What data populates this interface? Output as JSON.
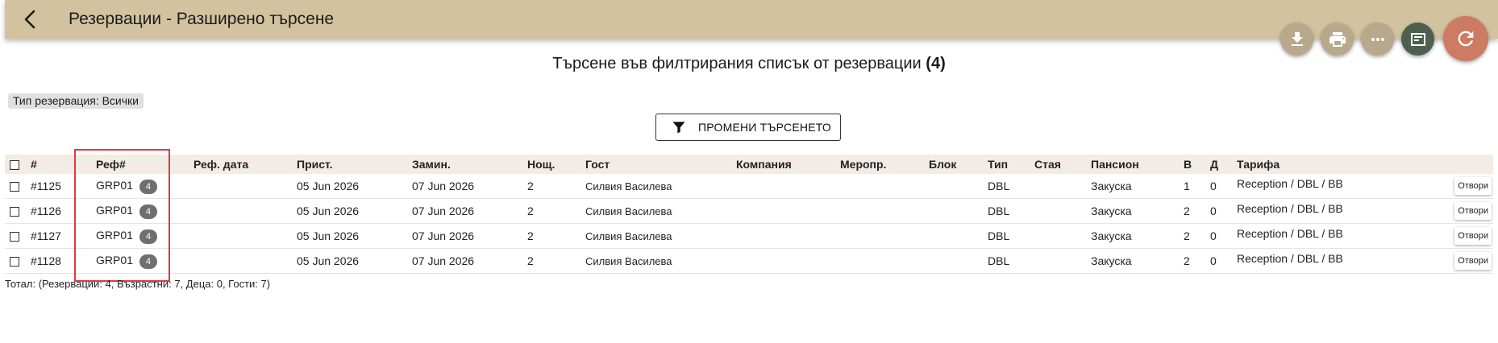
{
  "header": {
    "title": "Резервации - Разширено търсене",
    "back_icon": "arrow-back-icon"
  },
  "actions": [
    {
      "name": "download-button",
      "icon": "download-icon"
    },
    {
      "name": "print-button",
      "icon": "print-icon"
    },
    {
      "name": "more-button",
      "icon": "more-horizontal-icon"
    },
    {
      "name": "details-button",
      "icon": "list-alt-icon"
    },
    {
      "name": "refresh-button",
      "icon": "refresh-icon"
    }
  ],
  "search": {
    "heading": "Търсене във филтрирания списък от резервации",
    "count": "(4)",
    "chip": "Тип резервация: Всички",
    "change_button": "ПРОМЕНИ ТЪРСЕНЕТО"
  },
  "table": {
    "columns": [
      "#",
      "Реф#",
      "Реф. дата",
      "Прист.",
      "Замин.",
      "Нощ.",
      "Гост",
      "Компания",
      "Меропр.",
      "Блок",
      "Тип",
      "Стая",
      "Пансион",
      "В",
      "Д",
      "Тарифа"
    ],
    "open_label": "Отвори",
    "rows": [
      {
        "id": "#1125",
        "ref": "GRP01",
        "count": "4",
        "ref_date": "",
        "arrival": "05 Jun 2026",
        "departure": "07 Jun 2026",
        "nights": "2",
        "guest": "Силвия Василева",
        "company": "",
        "event": "",
        "block": "",
        "type": "DBL",
        "room": "",
        "board": "Закуска",
        "adults": "1",
        "children": "0",
        "rate": "Reception / DBL / BB"
      },
      {
        "id": "#1126",
        "ref": "GRP01",
        "count": "4",
        "ref_date": "",
        "arrival": "05 Jun 2026",
        "departure": "07 Jun 2026",
        "nights": "2",
        "guest": "Силвия Василева",
        "company": "",
        "event": "",
        "block": "",
        "type": "DBL",
        "room": "",
        "board": "Закуска",
        "adults": "2",
        "children": "0",
        "rate": "Reception / DBL / BB"
      },
      {
        "id": "#1127",
        "ref": "GRP01",
        "count": "4",
        "ref_date": "",
        "arrival": "05 Jun 2026",
        "departure": "07 Jun 2026",
        "nights": "2",
        "guest": "Силвия Василева",
        "company": "",
        "event": "",
        "block": "",
        "type": "DBL",
        "room": "",
        "board": "Закуска",
        "adults": "2",
        "children": "0",
        "rate": "Reception / DBL / BB"
      },
      {
        "id": "#1128",
        "ref": "GRP01",
        "count": "4",
        "ref_date": "",
        "arrival": "05 Jun 2026",
        "departure": "07 Jun 2026",
        "nights": "2",
        "guest": "Силвия Василева",
        "company": "",
        "event": "",
        "block": "",
        "type": "DBL",
        "room": "",
        "board": "Закуска",
        "adults": "2",
        "children": "0",
        "rate": "Reception / DBL / BB"
      }
    ]
  },
  "total": "Тотал: (Резервации: 4, Възрастни: 7, Деца: 0, Гости: 7)",
  "colors": {
    "topbar": "#d2c29f",
    "fab": "#b8a98c",
    "fab_dark": "#4e5f4f",
    "fab_refresh": "#cd7b62",
    "header_row": "#f3ece4",
    "highlight": "#e0393e"
  }
}
